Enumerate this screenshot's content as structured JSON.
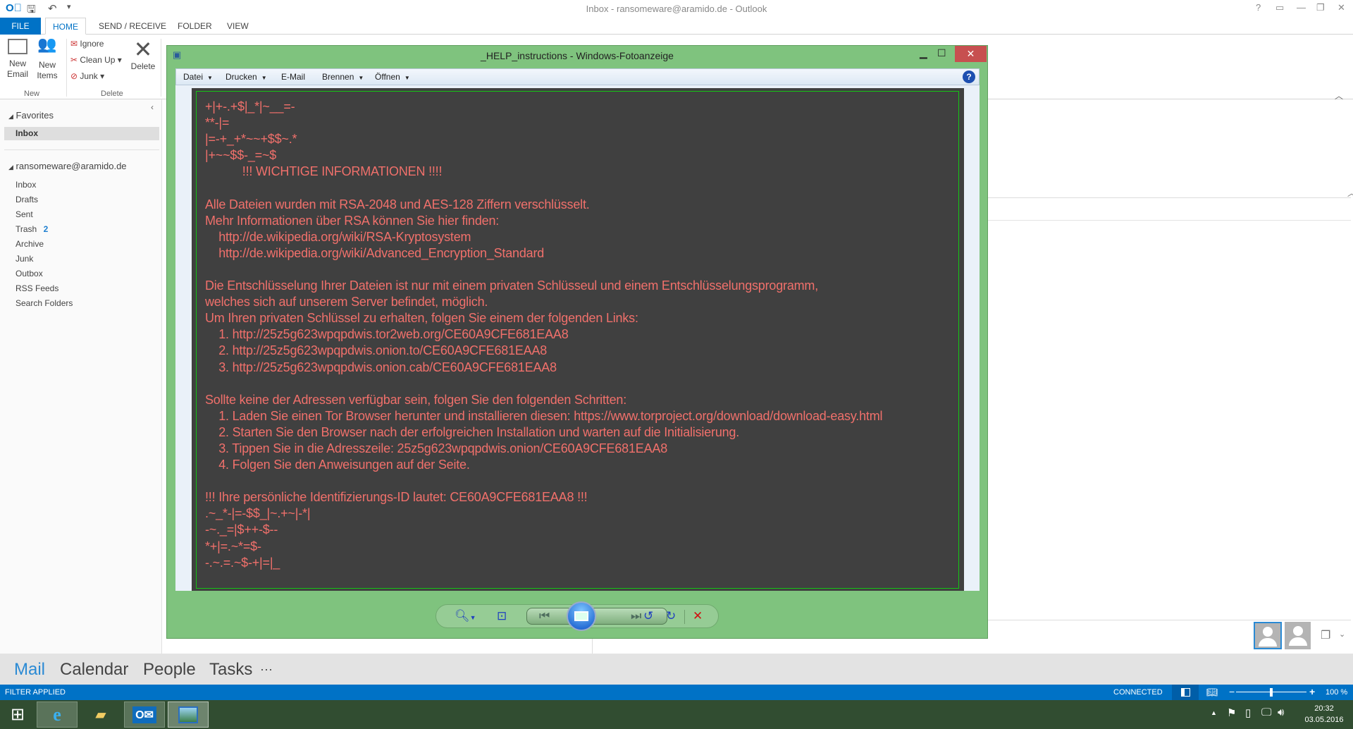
{
  "outlook": {
    "window_title": "Inbox - ransomeware@aramido.de - Outlook",
    "tabs": [
      "FILE",
      "HOME",
      "SEND / RECEIVE",
      "FOLDER",
      "VIEW"
    ],
    "ribbon": {
      "new_email": "New\nEmail",
      "new_items": "New\nItems",
      "ignore": "Ignore",
      "clean_up": "Clean Up",
      "junk": "Junk",
      "delete": "Delete",
      "group_new": "New",
      "group_delete": "Delete"
    },
    "favorites_header": "Favorites",
    "favorites": [
      {
        "label": "Inbox"
      }
    ],
    "account": "ransomeware@aramido.de",
    "folders": [
      {
        "label": "Inbox"
      },
      {
        "label": "Drafts"
      },
      {
        "label": "Sent"
      },
      {
        "label": "Trash",
        "count": "2"
      },
      {
        "label": "Archive"
      },
      {
        "label": "Junk"
      },
      {
        "label": "Outbox"
      },
      {
        "label": "RSS Feeds"
      },
      {
        "label": "Search Folders"
      }
    ],
    "bottom_nav": [
      "Mail",
      "Calendar",
      "People",
      "Tasks",
      "···"
    ],
    "status": {
      "left": "FILTER APPLIED",
      "connected": "CONNECTED",
      "zoom": "100 %",
      "zoom_level": 100
    }
  },
  "viewer": {
    "title": "_HELP_instructions - Windows-Fotoanzeige",
    "menu": [
      "Datei",
      "Drucken",
      "E-Mail",
      "Brennen",
      "Öffnen"
    ],
    "note_lines": [
      "+|+-.+$|_*|~__=-",
      "**-|=",
      "|=-+_+*~~+$$~.*",
      "|+~~$$-_=~$",
      "           !!! WICHTIGE INFORMATIONEN !!!!",
      "",
      "Alle Dateien wurden mit RSA-2048 und AES-128 Ziffern verschlüsselt.",
      "Mehr Informationen über RSA können Sie hier finden:",
      "    http://de.wikipedia.org/wiki/RSA-Kryptosystem",
      "    http://de.wikipedia.org/wiki/Advanced_Encryption_Standard",
      "",
      "Die Entschlüsselung Ihrer Dateien ist nur mit einem privaten Schlüsseul und einem Entschlüsselungsprogramm,",
      "welches sich auf unserem Server befindet, möglich.",
      "Um Ihren privaten Schlüssel zu erhalten, folgen Sie einem der folgenden Links:",
      "    1. http://25z5g623wpqpdwis.tor2web.org/CE60A9CFE681EAA8",
      "    2. http://25z5g623wpqpdwis.onion.to/CE60A9CFE681EAA8",
      "    3. http://25z5g623wpqpdwis.onion.cab/CE60A9CFE681EAA8",
      "",
      "Sollte keine der Adressen verfügbar sein, folgen Sie den folgenden Schritten:",
      "    1. Laden Sie einen Tor Browser herunter und installieren diesen: https://www.torproject.org/download/download-easy.html",
      "    2. Starten Sie den Browser nach der erfolgreichen Installation und warten auf die Initialisierung.",
      "    3. Tippen Sie in die Adresszeile: 25z5g623wpqpdwis.onion/CE60A9CFE681EAA8",
      "    4. Folgen Sie den Anweisungen auf der Seite.",
      "",
      "!!! Ihre persönliche Identifizierungs-ID lautet: CE60A9CFE681EAA8 !!!",
      ".~_*-|=-$$_|~.+~|-*|",
      "-~._=|$++-$--",
      "*+|=.~*=$-",
      "-.~.=.~$-+|=|_"
    ]
  },
  "taskbar": {
    "time": "20:32",
    "date": "03.05.2016"
  },
  "colors": {
    "accent": "#0072c6",
    "viewer_frame": "#7fc37e",
    "note_text": "#f0706b",
    "taskbar": "#314d31"
  }
}
